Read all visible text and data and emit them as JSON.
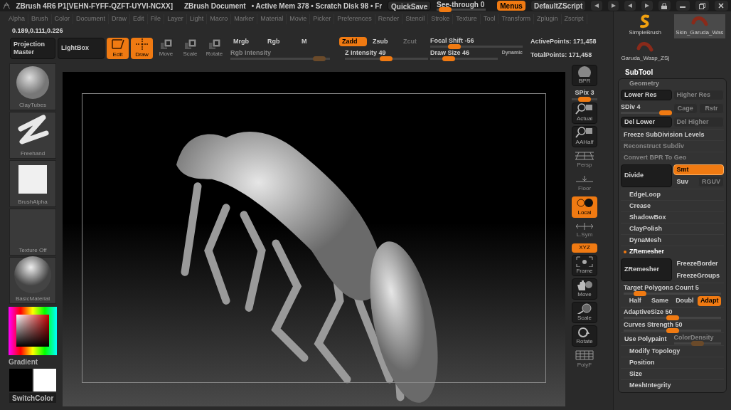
{
  "title_bar": {
    "app": "ZBrush 4R6 P1[VEHN-FYFF-QZFT-UYVI-NCXX]",
    "document": "ZBrush Document",
    "stats": "• Active Mem 378 • Scratch Disk 98 • Fr",
    "quicksave": "QuickSave",
    "see_through": {
      "label": "See-through  0",
      "level": 0.05
    },
    "menus": {
      "label": "Menus",
      "on": true
    },
    "script": "DefaultZScript"
  },
  "menu_bar": [
    "Alpha",
    "Brush",
    "Color",
    "Document",
    "Draw",
    "Edit",
    "File",
    "Layer",
    "Light",
    "Macro",
    "Marker",
    "Material",
    "Movie",
    "Picker",
    "Preferences",
    "Render",
    "Stencil",
    "Stroke",
    "Texture",
    "Tool",
    "Transform",
    "Zplugin",
    "Zscript"
  ],
  "color_readout": "0.189,0.111,0.226",
  "top_shelf": {
    "projection_master": "Projection Master",
    "lightbox": "LightBox",
    "modes": [
      {
        "label": "Edit",
        "on": true
      },
      {
        "label": "Draw",
        "on": true
      },
      {
        "label": "Move",
        "on": false
      },
      {
        "label": "Scale",
        "on": false
      },
      {
        "label": "Rotate",
        "on": false
      }
    ],
    "color_modes": [
      {
        "label": "Mrgb",
        "on": false
      },
      {
        "label": "Rgb",
        "on": false
      },
      {
        "label": "M",
        "on": false
      }
    ],
    "rgb_intensity": {
      "label": "Rgb Intensity",
      "level": 0.95,
      "disabled": true
    },
    "z_modes": [
      {
        "label": "Zadd",
        "on": true,
        "disabled": false
      },
      {
        "label": "Zsub",
        "on": false,
        "disabled": false
      },
      {
        "label": "Zcut",
        "on": false,
        "disabled": true
      }
    ],
    "z_intensity": {
      "label": "Z Intensity 49",
      "level": 0.49
    },
    "focal_shift": {
      "label": "Focal Shift -56",
      "level": 0.22
    },
    "draw_size": {
      "label": "Draw Size 46",
      "level": 0.22
    },
    "dynamic": "Dynamic",
    "active_points": "ActivePoints: 171,458",
    "total_points": "TotalPoints: 171,458"
  },
  "tool_thumbnails": [
    {
      "label": "SimpleBrush",
      "selected": false
    },
    {
      "label": "Skin_Garuda_Was",
      "selected": true
    },
    {
      "label": "Garuda_Wasp_ZSj",
      "selected": false
    }
  ],
  "left_shelf": {
    "thumbnails": [
      "ClayTubes",
      "Freehand",
      "BrushAlpha",
      "Texture Off",
      "BasicMaterial"
    ],
    "gradient": "Gradient",
    "switch_color": "SwitchColor"
  },
  "right_shelf": [
    {
      "label": "BPR",
      "kind": "button",
      "on": false
    },
    {
      "label": "SPix 3",
      "kind": "slider",
      "level": 0.5
    },
    {
      "label": "Actual",
      "kind": "button",
      "on": false
    },
    {
      "label": "AAHalf",
      "kind": "button",
      "on": false
    },
    {
      "label": "Persp",
      "kind": "plain",
      "on": false
    },
    {
      "label": "Floor",
      "kind": "plain",
      "on": false
    },
    {
      "label": "Local",
      "kind": "button",
      "on": true
    },
    {
      "label": "L.Sym",
      "kind": "plain",
      "on": false
    },
    {
      "label": "XYZ",
      "kind": "small",
      "on": true
    },
    {
      "label": "Frame",
      "kind": "button",
      "on": false
    },
    {
      "label": "Move",
      "kind": "button",
      "on": false
    },
    {
      "label": "Scale",
      "kind": "button",
      "on": false
    },
    {
      "label": "Rotate",
      "kind": "button",
      "on": false
    },
    {
      "label": "PolyF",
      "kind": "plain",
      "on": false
    }
  ],
  "right_panel": {
    "subtool": "SubTool",
    "geometry": {
      "title": "Geometry",
      "rows": [
        {
          "kind": "pair",
          "items": [
            {
              "label": "Lower Res",
              "disabled": false
            },
            {
              "label": "Higher Res",
              "disabled": true
            }
          ]
        },
        {
          "kind": "slider_pair",
          "slider": {
            "label": "SDiv 4",
            "level": 1
          },
          "items": [
            {
              "label": "Cage",
              "disabled": true
            },
            {
              "label": "Rstr",
              "disabled": true
            }
          ]
        },
        {
          "kind": "pair",
          "items": [
            {
              "label": "Del Lower",
              "disabled": false
            },
            {
              "label": "Del Higher",
              "disabled": true
            }
          ]
        },
        {
          "kind": "full",
          "label": "Freeze SubDivision Levels",
          "disabled": false
        },
        {
          "kind": "full",
          "label": "Reconstruct Subdiv",
          "disabled": true
        },
        {
          "kind": "full",
          "label": "Convert BPR To Geo",
          "disabled": true
        },
        {
          "kind": "divide",
          "big": "Divide",
          "items": [
            {
              "label": "Smt",
              "on": true,
              "disabled": false
            },
            {
              "label": "Suv",
              "on": false,
              "disabled": false
            },
            {
              "label": "RGUV",
              "on": false,
              "disabled": true
            }
          ]
        },
        {
          "kind": "section",
          "label": "EdgeLoop",
          "expanded": false
        },
        {
          "kind": "section",
          "label": "Crease",
          "expanded": false
        },
        {
          "kind": "section",
          "label": "ShadowBox",
          "expanded": false
        },
        {
          "kind": "section",
          "label": "ClayPolish",
          "expanded": false
        },
        {
          "kind": "section",
          "label": "DynaMesh",
          "expanded": false
        },
        {
          "kind": "section",
          "label": "ZRemesher",
          "expanded": true,
          "children": [
            {
              "kind": "big",
              "big": "ZRemesher",
              "items": [
                {
                  "label": "FreezeBorder",
                  "on": false
                },
                {
                  "label": "FreezeGroups",
                  "on": false
                }
              ]
            },
            {
              "kind": "slider",
              "label": "Target Polygons Count 5",
              "level": 0.12
            },
            {
              "kind": "choice",
              "items": [
                {
                  "label": "Half",
                  "selected": false
                },
                {
                  "label": "Same",
                  "selected": false
                },
                {
                  "label": "Doubl",
                  "selected": false
                },
                {
                  "label": "Adapt",
                  "selected": true
                }
              ]
            },
            {
              "kind": "slider",
              "label": "AdaptiveSize 50",
              "level": 0.5
            },
            {
              "kind": "slider",
              "label": "Curves Strength 50",
              "level": 0.5
            },
            {
              "kind": "toggle_slider",
              "toggle": {
                "label": "Use Polypaint",
                "on": false
              },
              "slider": {
                "label": "ColorDensity",
                "level": 0.5,
                "disabled": true
              }
            }
          ]
        },
        {
          "kind": "section",
          "label": "Modify Topology",
          "expanded": false
        },
        {
          "kind": "section",
          "label": "Position",
          "expanded": false
        },
        {
          "kind": "section",
          "label": "Size",
          "expanded": false
        },
        {
          "kind": "section",
          "label": "MeshIntegrity",
          "expanded": false
        }
      ]
    }
  }
}
